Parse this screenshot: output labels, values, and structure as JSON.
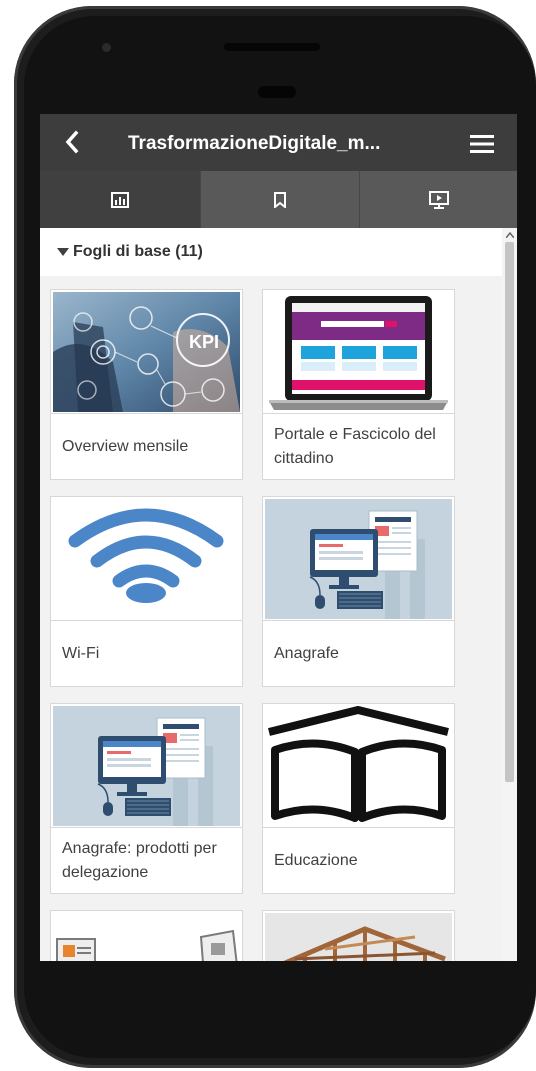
{
  "app": {
    "title": "TrasformazioneDigitale_m...",
    "back_icon": "chevron-left-icon",
    "menu_icon": "hamburger-menu-icon"
  },
  "tabs": [
    {
      "icon": "sheets-icon",
      "active": true
    },
    {
      "icon": "bookmark-icon",
      "active": false
    },
    {
      "icon": "story-icon",
      "active": false
    }
  ],
  "section": {
    "label": "Fogli di base (11)",
    "caret_icon": "caret-down-icon"
  },
  "sheets": [
    {
      "label": "Overview mensile",
      "thumbnail": "kpi-business-image"
    },
    {
      "label": "Portale e Fascicolo del cittadino",
      "thumbnail": "laptop-website-image"
    },
    {
      "label": "Wi-Fi",
      "thumbnail": "wifi-image"
    },
    {
      "label": "Anagrafe",
      "thumbnail": "computer-desk-illustration"
    },
    {
      "label": "Anagrafe: prodotti per delegazione",
      "thumbnail": "computer-desk-illustration"
    },
    {
      "label": "Educazione",
      "thumbnail": "open-book-image"
    },
    {
      "label": "",
      "thumbnail": "documents-image"
    },
    {
      "label": "",
      "thumbnail": "house-construction-image"
    }
  ],
  "colors": {
    "topbar": "#3d3d3d",
    "tabbar": "#595959",
    "active_tab": "#404040",
    "wifi_blue": "#4a86c8",
    "accent_magenta": "#e0116b"
  }
}
